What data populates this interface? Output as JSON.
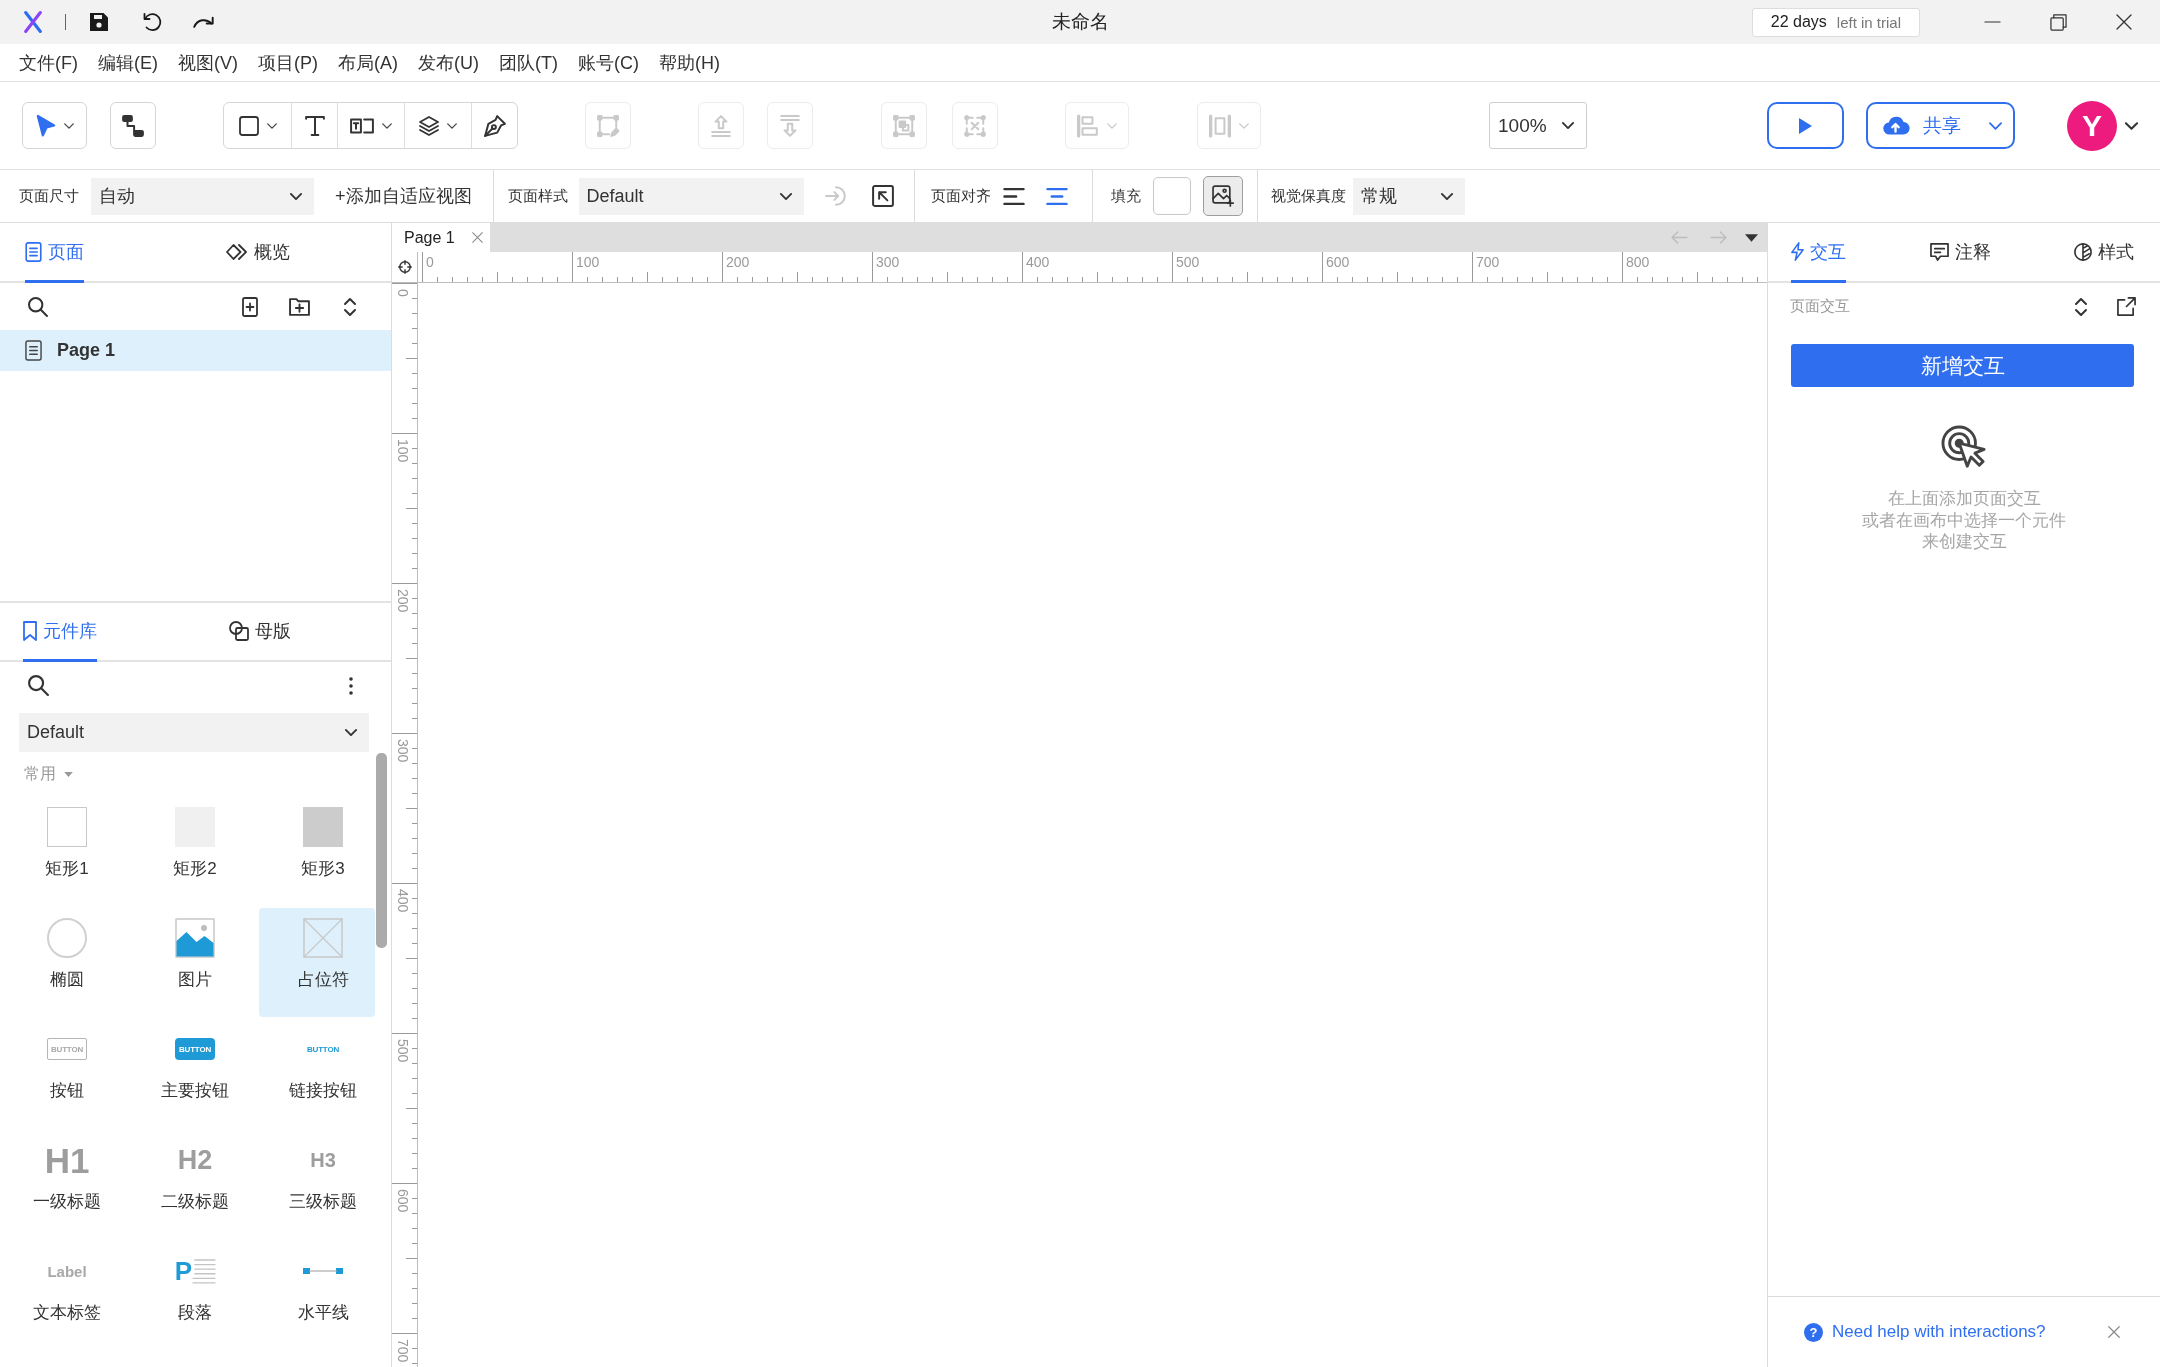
{
  "window": {
    "title": "未命名",
    "trial_days": "22 days",
    "trial_text": "left in trial"
  },
  "menu": [
    "文件(F)",
    "编辑(E)",
    "视图(V)",
    "项目(P)",
    "布局(A)",
    "发布(U)",
    "团队(T)",
    "账号(C)",
    "帮助(H)"
  ],
  "toolbar": {
    "tools": [
      {
        "selected": true,
        "dropdown": true
      },
      {
        "selected": false,
        "dropdown": false
      }
    ],
    "insert_tools": [
      {
        "selected": false,
        "dropdown": true
      },
      {
        "selected": false,
        "dropdown": false
      },
      {
        "selected": false,
        "dropdown": true
      },
      {
        "selected": false,
        "dropdown": true
      },
      {
        "selected": false,
        "dropdown": false
      }
    ],
    "arrange_tools": [
      {
        "disabled": true,
        "dropdown": false
      },
      {
        "disabled": true,
        "dropdown": false
      },
      {
        "disabled": true,
        "dropdown": false
      },
      {
        "disabled": true,
        "dropdown": false
      },
      {
        "disabled": true,
        "dropdown": false
      },
      {
        "disabled": true,
        "dropdown": true
      },
      {
        "disabled": true,
        "dropdown": true
      }
    ],
    "zoom": "100%",
    "share": "共享",
    "avatar": "Y"
  },
  "page_bar": {
    "size_label": "页面尺寸",
    "size_value": "自动",
    "add_view": "+添加自适应视图",
    "style_label": "页面样式",
    "style_value": "Default",
    "actions": [
      {
        "disabled": true
      },
      {
        "disabled": false
      }
    ],
    "align_label": "页面对齐",
    "align": [
      {
        "selected": false
      },
      {
        "selected": true
      }
    ],
    "fill_label": "填充",
    "fidelity_label": "视觉保真度",
    "fidelity_value": "常规"
  },
  "pages_panel": {
    "tabs": [
      {
        "label": "页面",
        "selected": true
      },
      {
        "label": "概览",
        "selected": false
      }
    ],
    "pages": [
      {
        "label": "Page 1",
        "selected": true
      }
    ]
  },
  "library_panel": {
    "tabs": [
      {
        "label": "元件库",
        "selected": true
      },
      {
        "label": "母版",
        "selected": false
      }
    ],
    "library": "Default",
    "category": "常用",
    "widgets": [
      {
        "label": "矩形1",
        "kind": "square-outline",
        "selected": false
      },
      {
        "label": "矩形2",
        "kind": "square-light",
        "selected": false
      },
      {
        "label": "矩形3",
        "kind": "square-shaded",
        "selected": false
      },
      {
        "label": "椭圆",
        "kind": "ellipse",
        "selected": false
      },
      {
        "label": "图片",
        "kind": "image",
        "selected": false
      },
      {
        "label": "占位符",
        "kind": "placeholder",
        "selected": true
      },
      {
        "label": "按钮",
        "kind": "button",
        "icon_text": "BUTTON",
        "selected": false
      },
      {
        "label": "主要按钮",
        "kind": "primary-button",
        "icon_text": "BUTTON",
        "selected": false
      },
      {
        "label": "链接按钮",
        "kind": "link-button",
        "icon_text": "BUTTON",
        "selected": false
      },
      {
        "label": "一级标题",
        "kind": "heading-1",
        "icon_text": "H1",
        "selected": false
      },
      {
        "label": "二级标题",
        "kind": "heading-2",
        "icon_text": "H2",
        "selected": false
      },
      {
        "label": "三级标题",
        "kind": "heading-3",
        "icon_text": "H3",
        "selected": false
      },
      {
        "label": "文本标签",
        "kind": "label",
        "icon_text": "Label",
        "selected": false
      },
      {
        "label": "段落",
        "kind": "paragraph",
        "icon_text": "P",
        "selected": false
      },
      {
        "label": "水平线",
        "kind": "line",
        "selected": false
      }
    ]
  },
  "canvas": {
    "tabs": [
      {
        "label": "Page 1",
        "selected": true
      }
    ],
    "nav": [
      {
        "disabled": true
      },
      {
        "disabled": true
      }
    ],
    "x_ruler": [
      "0",
      "100",
      "200",
      "300",
      "400",
      "500",
      "600",
      "700",
      "800"
    ],
    "y_ruler": [
      "0",
      "100",
      "200",
      "300",
      "400",
      "500",
      "600",
      "700"
    ]
  },
  "interactions_panel": {
    "tabs": [
      {
        "label": "交互",
        "selected": true
      },
      {
        "label": "注释",
        "selected": false
      },
      {
        "label": "样式",
        "selected": false
      }
    ],
    "section": "页面交互",
    "add_button": "新增交互",
    "empty_text": [
      "在上面添加页面交互",
      "或者在画布中选择一个元件",
      "来创建交互"
    ],
    "help_icon": "?",
    "help": "Need help with interactions?"
  }
}
